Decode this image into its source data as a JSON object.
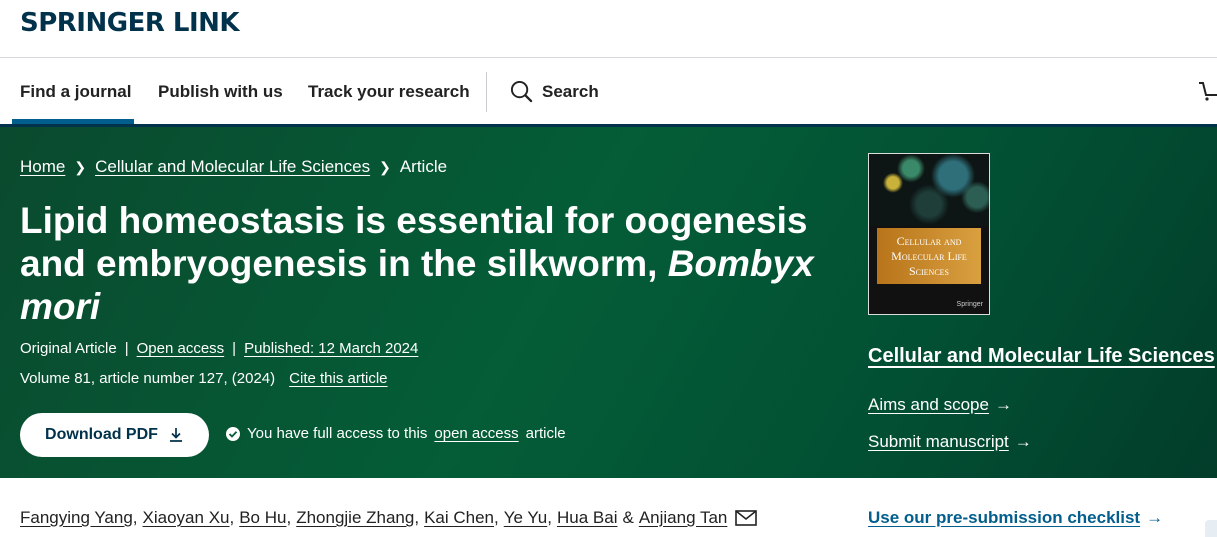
{
  "brand": "SPRINGER LINK",
  "nav": {
    "items": [
      "Find a journal",
      "Publish with us",
      "Track your research"
    ],
    "search_label": "Search"
  },
  "breadcrumb": {
    "home": "Home",
    "journal": "Cellular and Molecular Life Sciences",
    "current": "Article"
  },
  "article": {
    "title_main": "Lipid homeostasis is essential for oogenesis and embryogenesis in the silkworm, ",
    "title_italic": "Bombyx mori",
    "type": "Original Article",
    "access": "Open access",
    "published": "Published: 12 March 2024",
    "volume": "Volume 81, article number 127, (2024)",
    "cite": "Cite this article",
    "download_label": "Download PDF",
    "access_note_pre": "You have full access to this",
    "access_note_link": "open access",
    "access_note_post": "article"
  },
  "journal": {
    "cover_title_lines": [
      "Cellular and",
      "Molecular Life",
      "Sciences"
    ],
    "cover_publisher": "Springer",
    "name": "Cellular and Molecular Life Sciences",
    "links": [
      "Aims and scope",
      "Submit manuscript"
    ],
    "checklist": "Use our pre-submission checklist"
  },
  "authors": [
    "Fangying Yang",
    "Xiaoyan Xu",
    "Bo Hu",
    "Zhongjie Zhang",
    "Kai Chen",
    "Ye Yu",
    "Hua Bai",
    "Anjiang Tan"
  ],
  "colors": {
    "brand": "#01324b",
    "hero_green": "#045d37",
    "link_blue": "#025e8d"
  }
}
